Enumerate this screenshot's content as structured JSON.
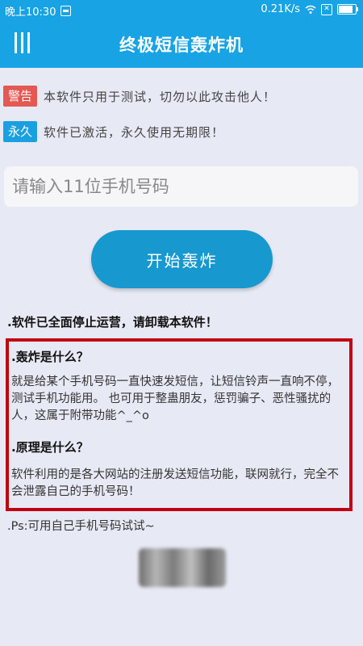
{
  "status_bar": {
    "time": "晚上10:30",
    "speed": "0.21K/s",
    "icons": [
      "notification-icon",
      "wifi-icon",
      "sim-icon",
      "battery-icon"
    ]
  },
  "app_bar": {
    "title": "终极短信轰炸机",
    "menu_icon": "menu-icon"
  },
  "notices": [
    {
      "tag": "警告",
      "text": "本软件只用于测试，切勿以此攻击他人！",
      "color": "#e35852"
    },
    {
      "tag": "永久",
      "text": "软件已激活，永久使用无期限！",
      "color": "#1aa0e0"
    }
  ],
  "phone_input": {
    "placeholder": "请输入11位手机号码",
    "value": ""
  },
  "start_button": {
    "label": "开始轰炸"
  },
  "stop_notice": ".软件已全面停止运营，请卸载本软件！",
  "info": {
    "q1": ".轰炸是什么？",
    "a1": "就是给某个手机号码一直快速发短信，让短信铃声一直响不停，测试手机功能用。 也可用于整蛊朋友，惩罚骗子、恶性骚扰的人，这属于附带功能^_^o",
    "q2": ".原理是什么？",
    "a2": "软件利用的是各大网站的注册发送短信功能，联网就行，完全不会泄露自己的手机号码！"
  },
  "ps": ".Ps:可用自己手机号码试试~",
  "colors": {
    "primary": "#17a3e4",
    "button": "#1799cf",
    "highlight_border": "#c00010",
    "background": "#e7e9f4"
  }
}
